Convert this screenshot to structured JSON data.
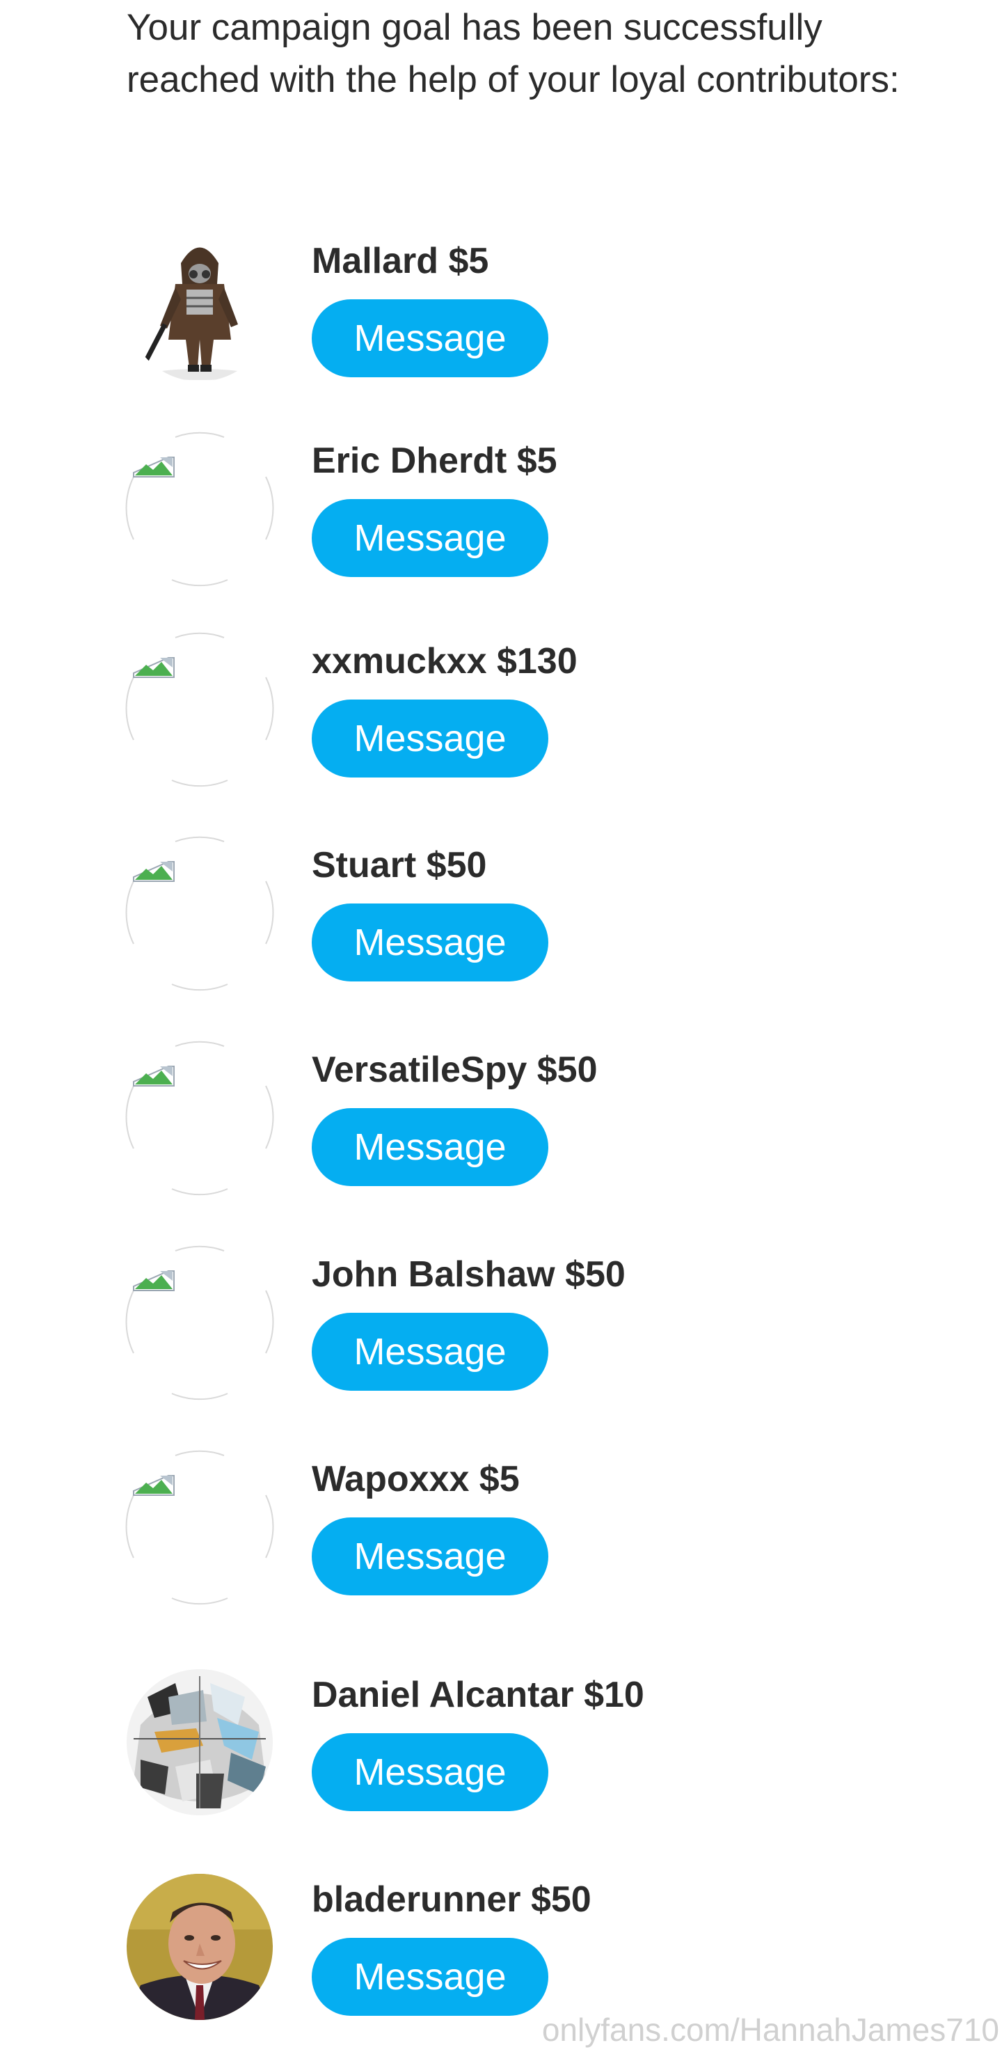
{
  "intro_text": "Your campaign goal has been successfully reached with the help of your loyal contributors:",
  "contributors": [
    {
      "label": "Mallard $5",
      "button": "Message",
      "avatar": "hooded-character-icon"
    },
    {
      "label": "Eric Dherdt $5",
      "button": "Message",
      "avatar": "broken-image-icon"
    },
    {
      "label": "xxmuckxx $130",
      "button": "Message",
      "avatar": "broken-image-icon"
    },
    {
      "label": "Stuart $50",
      "button": "Message",
      "avatar": "broken-image-icon"
    },
    {
      "label": "VersatileSpy $50",
      "button": "Message",
      "avatar": "broken-image-icon"
    },
    {
      "label": "John Balshaw $50",
      "button": "Message",
      "avatar": "broken-image-icon"
    },
    {
      "label": "Wapoxxx $5",
      "button": "Message",
      "avatar": "broken-image-icon"
    },
    {
      "label": "Daniel Alcantar $10",
      "button": "Message",
      "avatar": "helmet-art-icon"
    },
    {
      "label": "bladerunner $50",
      "button": "Message",
      "avatar": "smiling-man-photo"
    }
  ],
  "watermark": "onlyfans.com/HannahJames710",
  "colors": {
    "button_bg": "#05aef1",
    "button_text": "#ffffff",
    "text": "#2b2b2b",
    "watermark": "#d0d0d0"
  }
}
